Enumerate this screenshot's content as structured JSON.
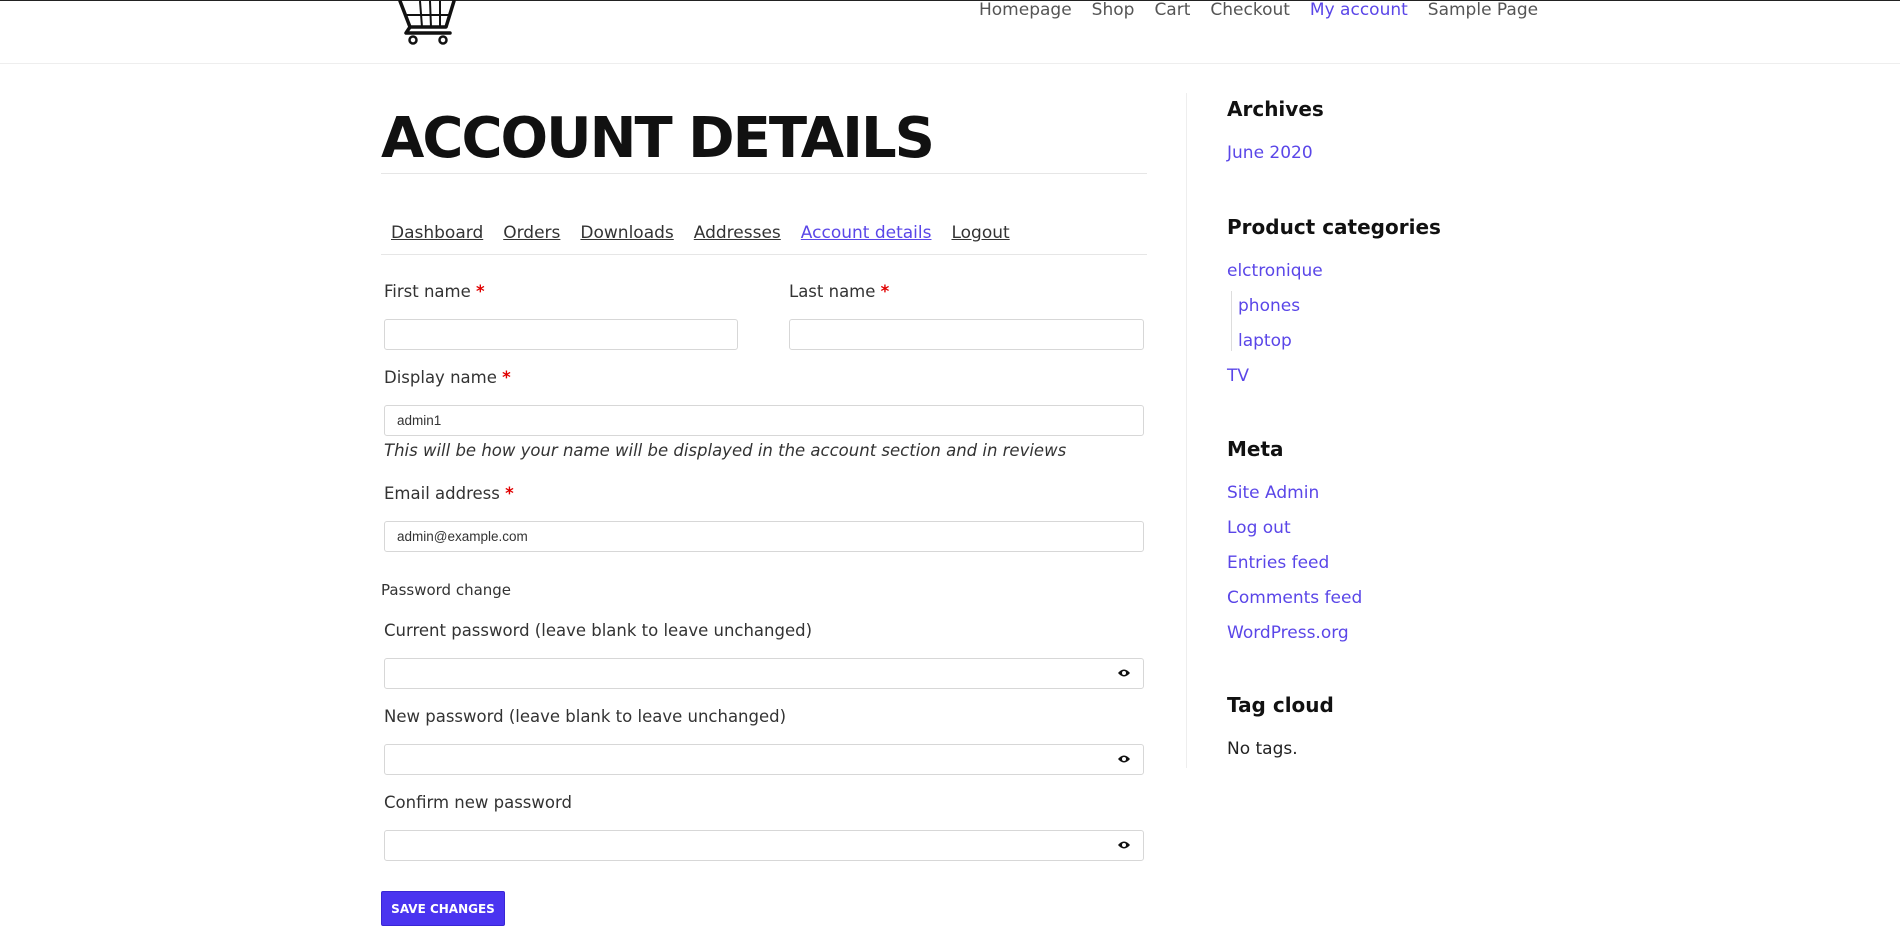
{
  "header": {
    "nav": [
      "Homepage",
      "Shop",
      "Cart",
      "Checkout",
      "My account",
      "Sample Page"
    ],
    "active_nav": "My account"
  },
  "main": {
    "title": "ACCOUNT DETAILS",
    "account_nav": [
      "Dashboard",
      "Orders",
      "Downloads",
      "Addresses",
      "Account details",
      "Logout"
    ],
    "active_account_nav": "Account details",
    "first_name_label": "First name",
    "last_name_label": "Last name",
    "display_name_label": "Display name",
    "display_name_value": "admin1",
    "display_name_hint": "This will be how your name will be displayed in the account section and in reviews",
    "email_label": "Email address",
    "email_value": "admin@example.com",
    "required_mark": "*",
    "password_fieldset": "Password change",
    "current_password_label": "Current password (leave blank to leave unchanged)",
    "new_password_label": "New password (leave blank to leave unchanged)",
    "confirm_password_label": "Confirm new password",
    "save_button": "SAVE CHANGES"
  },
  "sidebar": {
    "archives_title": "Archives",
    "archives": [
      "June 2020"
    ],
    "categories_title": "Product categories",
    "categories": [
      {
        "label": "elctronique",
        "children": [
          "phones",
          "laptop"
        ]
      },
      {
        "label": "TV",
        "children": []
      }
    ],
    "meta_title": "Meta",
    "meta_links": [
      "Site Admin",
      "Log out",
      "Entries feed",
      "Comments feed",
      "WordPress.org"
    ],
    "tagcloud_title": "Tag cloud",
    "tagcloud_text": "No tags."
  },
  "colors": {
    "accent": "#5a46e8",
    "button": "#4a34f0",
    "required": "#e00000"
  },
  "icons": [
    "cart-logo-icon",
    "eye-icon"
  ]
}
